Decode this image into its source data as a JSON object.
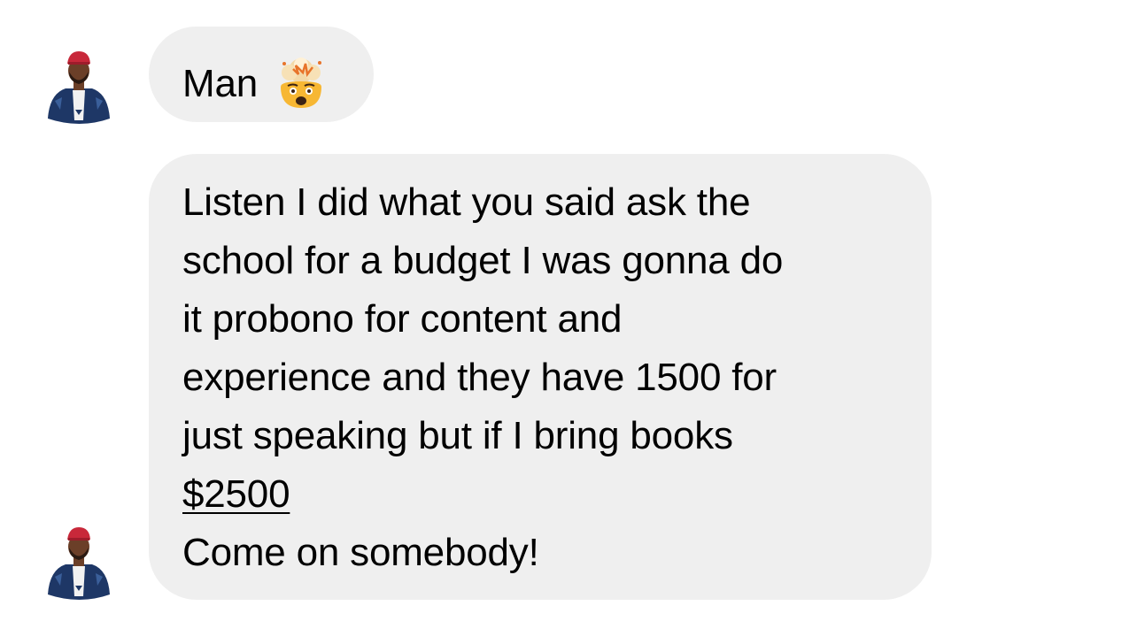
{
  "conversation": {
    "messages": [
      {
        "sender_avatar": "avatar-man-red-cap",
        "text": "Man",
        "emoji": "exploding-head-icon"
      },
      {
        "sender_avatar": "avatar-man-red-cap",
        "lines": [
          "Listen I did what you said ask the",
          "school for a budget I was gonna do",
          "it probono for content and",
          "experience and they have 1500 for",
          "just speaking but if I bring books",
          "$2500",
          "Come on somebody!"
        ]
      }
    ]
  },
  "colors": {
    "bubble_background": "#efefef",
    "text": "#000000",
    "page_background": "#ffffff"
  }
}
